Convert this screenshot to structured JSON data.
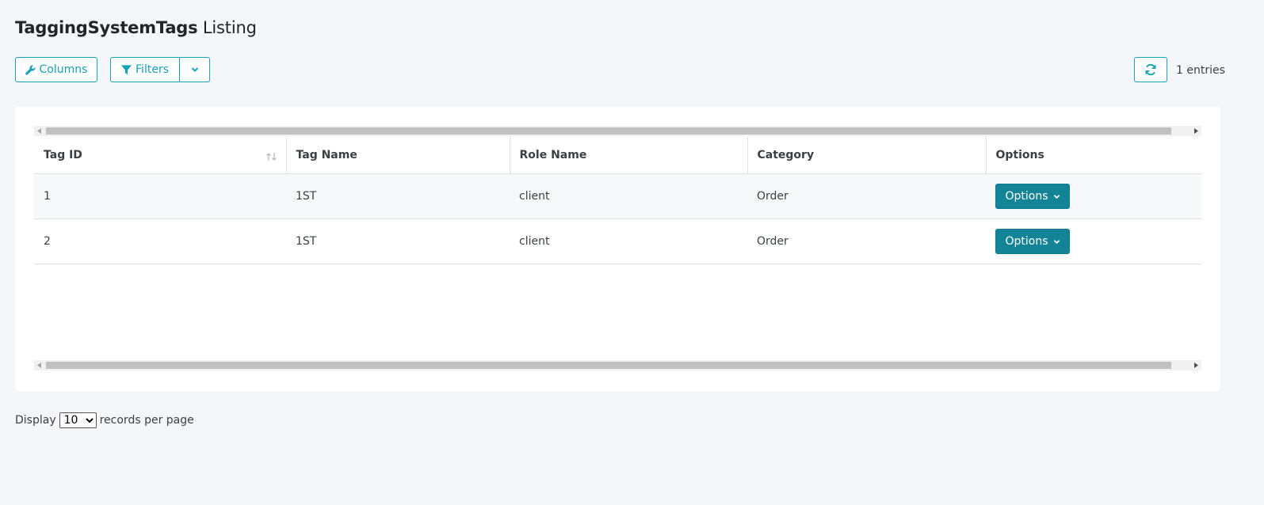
{
  "page": {
    "title_bold": "TaggingSystemTags",
    "title_rest": "Listing"
  },
  "toolbar": {
    "columns_label": "Columns",
    "filters_label": "Filters",
    "entries_text": "1 entries"
  },
  "table": {
    "headers": {
      "tag_id": "Tag ID",
      "tag_name": "Tag Name",
      "role_name": "Role Name",
      "category": "Category",
      "options": "Options"
    },
    "rows": [
      {
        "tag_id": "1",
        "tag_name": "1ST",
        "role_name": "client",
        "category": "Order",
        "options_label": "Options"
      },
      {
        "tag_id": "2",
        "tag_name": "1ST",
        "role_name": "client",
        "category": "Order",
        "options_label": "Options"
      }
    ]
  },
  "pagination": {
    "display_label": "Display",
    "per_page_selected": "10",
    "per_page_options": [
      "10"
    ],
    "suffix_label": "records per page"
  },
  "colors": {
    "accent": "#17a2b8",
    "options_button": "#138496",
    "background": "#f5f6fa"
  },
  "icons": {
    "columns": "wrench-icon",
    "filters": "filter-icon",
    "dropdown": "chevron-down-icon",
    "refresh": "refresh-icon",
    "sort": "sort-icon"
  }
}
